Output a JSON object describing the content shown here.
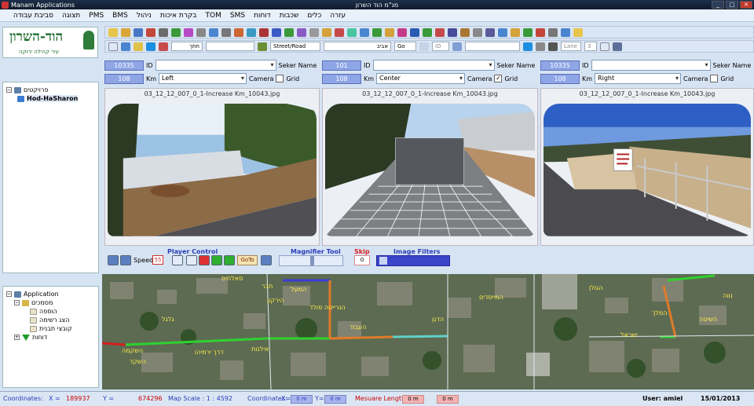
{
  "window": {
    "app_title": "Manam Applications",
    "center_title": "מנ\"מ הוד השרון"
  },
  "menu": [
    "עזרה",
    "כלים",
    "שכבות",
    "דוחות",
    "SMS",
    "TOM",
    "בקרת איכות",
    "ניהול",
    "BMS",
    "PMS",
    "תצוגה",
    "סביבת עבודה"
  ],
  "logo": {
    "brand": "הוד-השרון",
    "slogan": "עיר קהילה ירוקה"
  },
  "project_tree": {
    "root_label": "פרויקטים",
    "child_label": "Hod-HaSharon"
  },
  "app_tree": {
    "root_label": "Application",
    "folder_label": "מסמכים",
    "items": [
      "הוספה",
      "הצג רשימה",
      "קובצי תבנית"
    ],
    "reports_label": "דוחות"
  },
  "toolbar2": {
    "field1": "חתך",
    "field2": "Street/Road",
    "field3": "אביב",
    "go_label": "Go",
    "lane_label": "Lane",
    "lane_value": "3",
    "id_label": "ID"
  },
  "cameras": [
    {
      "id_value": "10335",
      "id_label": "ID",
      "seker_label": "Seker Name",
      "km_value": "108",
      "km_label": "Km",
      "position": "Left",
      "camera_label": "Camera",
      "grid_label": "Grid",
      "grid_checked": false,
      "filename": "03_12_12_007_0_1-Increase Km_10043.jpg"
    },
    {
      "id_value": "101",
      "id_label": "ID",
      "seker_label": "Seker Name",
      "km_value": "108",
      "km_label": "Km",
      "position": "Center",
      "camera_label": "Camera",
      "grid_label": "Grid",
      "grid_checked": true,
      "filename": "03_12_12_007_0_1-Increase Km_10043.jpg"
    },
    {
      "id_value": "10335",
      "id_label": "ID",
      "seker_label": "Seker Name",
      "km_value": "108",
      "km_label": "Km",
      "position": "Right",
      "camera_label": "Camera",
      "grid_label": "Grid",
      "grid_checked": false,
      "filename": "03_12_12_007_0_1-Increase Km_10043.jpg"
    }
  ],
  "player": {
    "title": "Player Control",
    "speed_label": "Speed",
    "speed_value": "55",
    "goto_label": "GoTo",
    "magnifier_title": "Magnifier Tool",
    "skip_title": "Skip",
    "skip_value": "0",
    "filters_title": "Image Filters"
  },
  "map": {
    "street_labels": [
      "סאלחיס",
      "חבר",
      "המעל",
      "הירקון",
      "הנרייטה סולד",
      "העבוד",
      "השקמה",
      "השקד",
      "גלגל",
      "דרך ירמיהו",
      "אילנות",
      "הדגן",
      "המייסדים",
      "הגולן",
      "ישראל",
      "המלך",
      "נווה",
      "השיטה"
    ],
    "road_colors": {
      "good": "#2fd12f",
      "fair": "#e07b2a",
      "poor": "#d11f1f",
      "link": "#3b3bd6"
    }
  },
  "status": {
    "coords_label": "Coordinates:",
    "x_label": "X =",
    "x_value": "189937",
    "y_label": "Y =",
    "y_value": "674296",
    "scale_label": "Map Scale : 1 : 4592",
    "coords2_label": "Coordinates:",
    "x2_label": "X=",
    "x2_value": "0 m",
    "y2_label": "Y=",
    "y2_value": "0 m",
    "measure_label": "Mesuare Length:",
    "measure_a": "0 m",
    "measure_b": "0 m",
    "user": "User: amiel",
    "date": "15/01/2013"
  }
}
